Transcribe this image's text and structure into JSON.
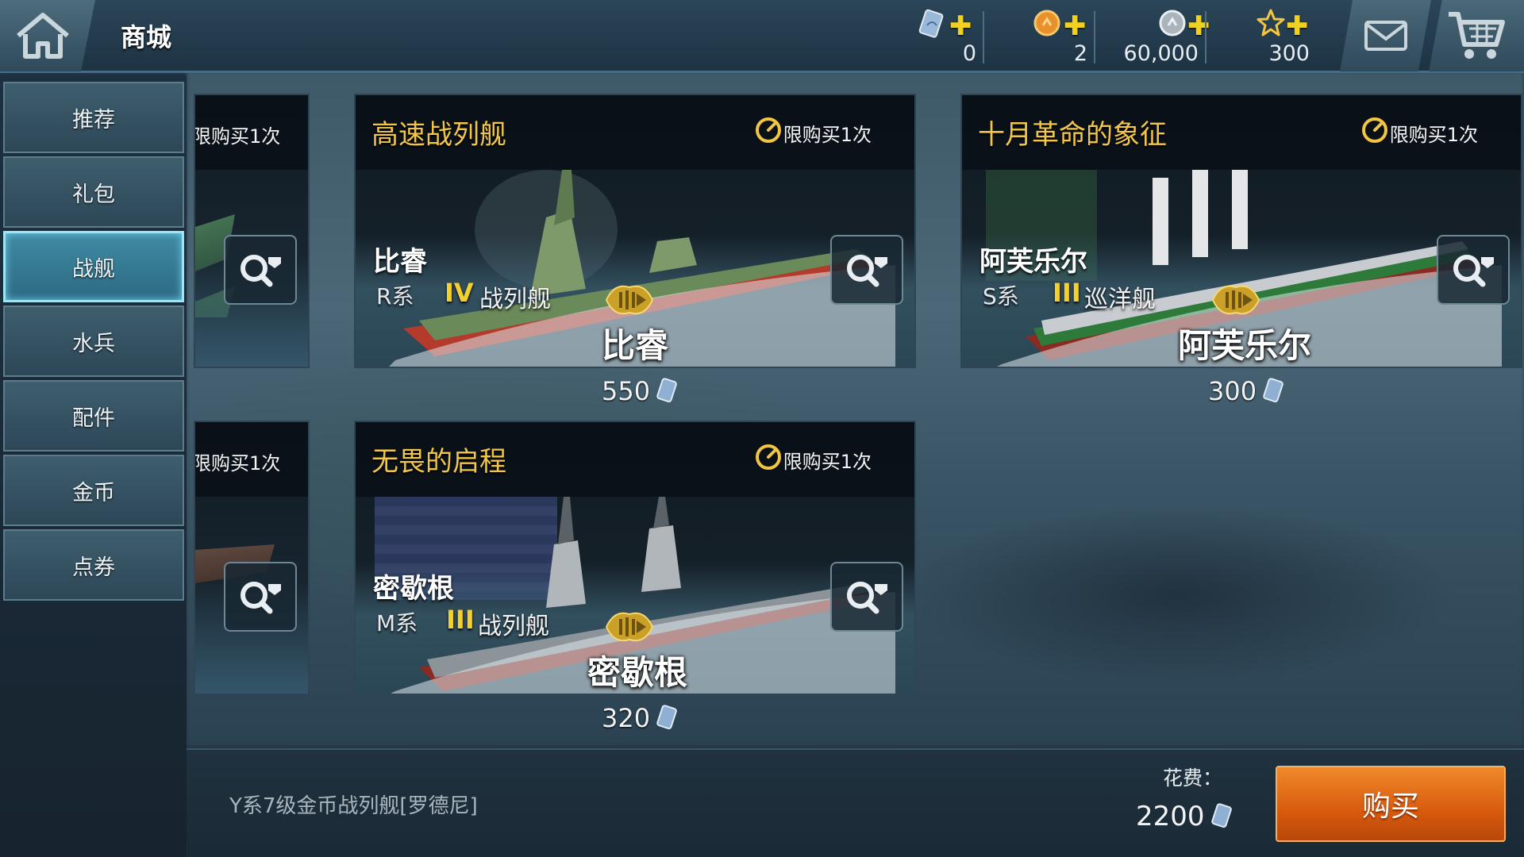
{
  "header": {
    "title": "商城",
    "currencies": [
      {
        "icon": "voucher-icon",
        "value": "0"
      },
      {
        "icon": "gold-coin-icon",
        "value": "2"
      },
      {
        "icon": "silver-coin-icon",
        "value": "60,000"
      },
      {
        "icon": "star-icon",
        "value": "300"
      }
    ]
  },
  "sidebar": {
    "items": [
      {
        "label": "推荐"
      },
      {
        "label": "礼包"
      },
      {
        "label": "战舰",
        "active": true
      },
      {
        "label": "水兵"
      },
      {
        "label": "配件"
      },
      {
        "label": "金币"
      },
      {
        "label": "点券"
      }
    ]
  },
  "partial_cards": [
    {
      "limit": "限购买1次"
    },
    {
      "limit": "限购买1次"
    }
  ],
  "cards": [
    {
      "title": "高速战列舰",
      "limit": "限购买1次",
      "ship_name": "比睿",
      "series": "R系",
      "tier": "IV",
      "type": "战列舰",
      "price": "550"
    },
    {
      "title": "十月革命的象征",
      "limit": "限购买1次",
      "ship_name": "阿芙乐尔",
      "series": "S系",
      "tier": "III",
      "type": "巡洋舰",
      "price": "300"
    },
    {
      "title": "无畏的启程",
      "limit": "限购买1次",
      "ship_name": "密歇根",
      "series": "M系",
      "tier": "III",
      "type": "战列舰",
      "price": "320"
    }
  ],
  "footer": {
    "description": "Y系7级金币战列舰[罗德尼]",
    "cost_label": "花费：",
    "cost_value": "2200",
    "buy_label": "购买"
  },
  "colors": {
    "title_gold": "#f2c64a",
    "tier_yellow": "#f2d030",
    "active_tab": "#3f8aa3",
    "buy_orange": "#e06a18"
  }
}
